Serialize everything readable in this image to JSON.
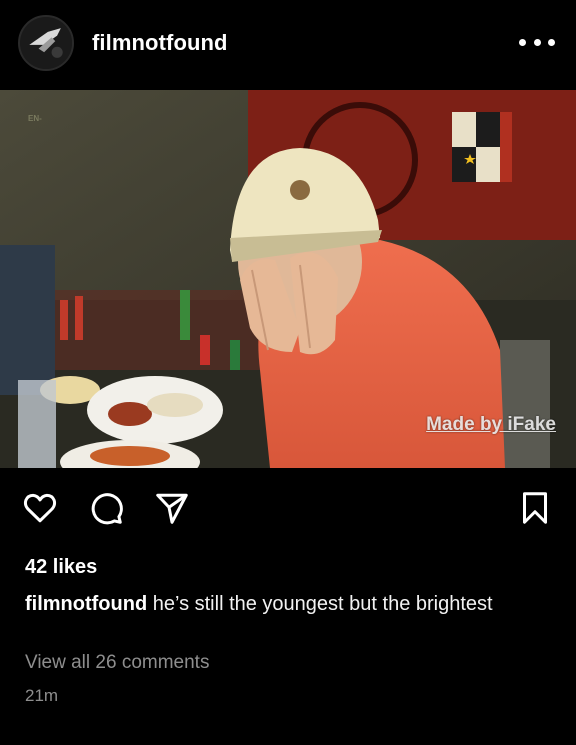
{
  "post": {
    "username": "filmnotfound",
    "watermark": "Made by iFake",
    "photo_tag": "EN-",
    "likes_text": "42 likes",
    "caption_user": "filmnotfound",
    "caption_text": " he’s still the youngest but the brightest",
    "view_comments": "View all 26 comments",
    "timestamp": "21m"
  },
  "icons": {
    "more": "more-dots-icon",
    "like": "heart-icon",
    "comment": "comment-bubble-icon",
    "share": "paper-plane-icon",
    "save": "bookmark-icon"
  },
  "colors": {
    "background": "#000000",
    "secondary_text": "#8e8e8e",
    "shirt": "#e8674a"
  }
}
